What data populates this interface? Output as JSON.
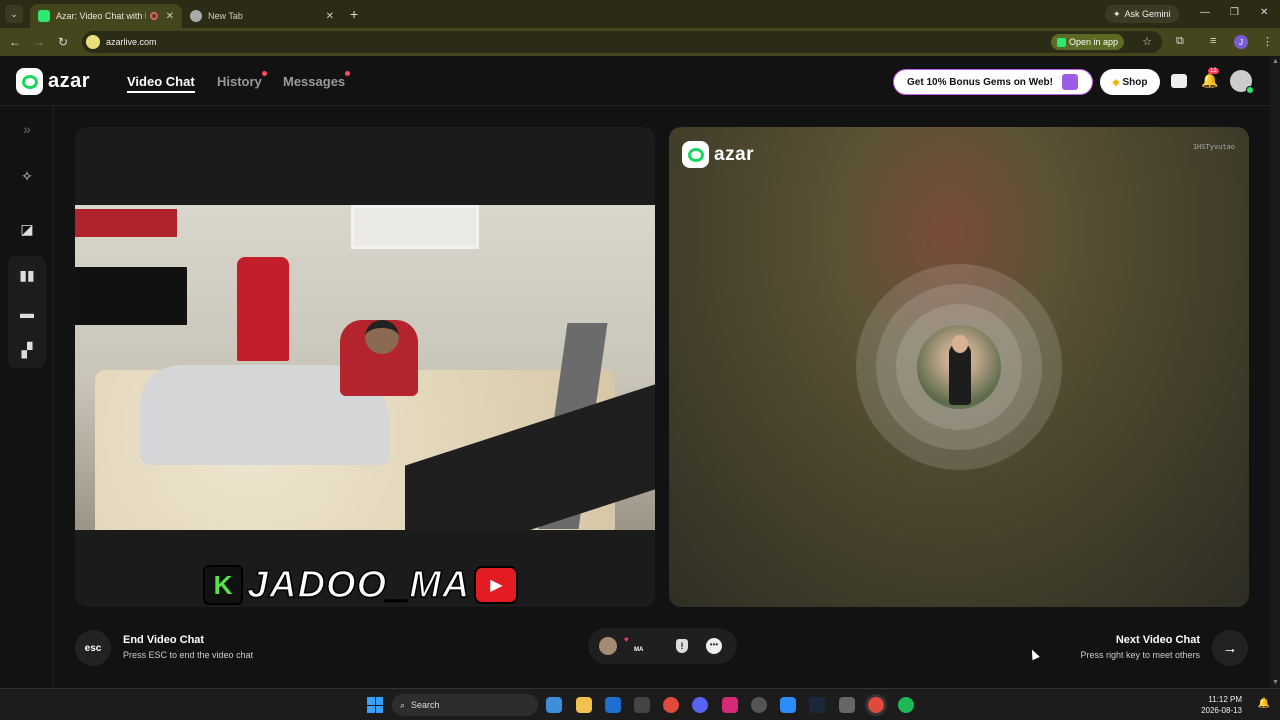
{
  "browser": {
    "tabs": [
      {
        "title": "Azar: Video Chat with New",
        "active": true,
        "recording": true
      },
      {
        "title": "New Tab",
        "active": false
      }
    ],
    "ask_gemini": "Ask Gemini",
    "url": "azarlive.com",
    "open_in_app": "Open in app",
    "profile_initial": "J"
  },
  "header": {
    "logo_text": "azar",
    "nav": [
      {
        "label": "Video Chat",
        "active": true,
        "dot": false
      },
      {
        "label": "History",
        "active": false,
        "dot": true
      },
      {
        "label": "Messages",
        "active": false,
        "dot": true
      }
    ],
    "bonus_label": "Get 10% Bonus Gems on Web!",
    "shop_label": "Shop",
    "notifications_count": "13"
  },
  "sidebar": {
    "icons": [
      "expand-icon",
      "magic-wand-icon",
      "filter-icon",
      "layout-side-by-side-icon",
      "layout-stacked-icon",
      "layout-grid-icon"
    ]
  },
  "left_video": {
    "watermark_badge": "K",
    "watermark_text": "JADOO_MA"
  },
  "right_video": {
    "logo_text": "azar",
    "session_id": "1HSTyvutao"
  },
  "bottom": {
    "esc_label": "esc",
    "end_title": "End Video Chat",
    "end_sub": "Press ESC to end the video chat",
    "mini_label": "MA",
    "next_title": "Next Video Chat",
    "next_sub": "Press right key to meet others"
  },
  "taskbar": {
    "search_label": "Search",
    "time": "11:12 PM",
    "date": "2026-08-13"
  },
  "colors": {
    "brand_green": "#1ad760",
    "chrome_frame": "#45451e",
    "badge_red": "#ff3b5c"
  }
}
